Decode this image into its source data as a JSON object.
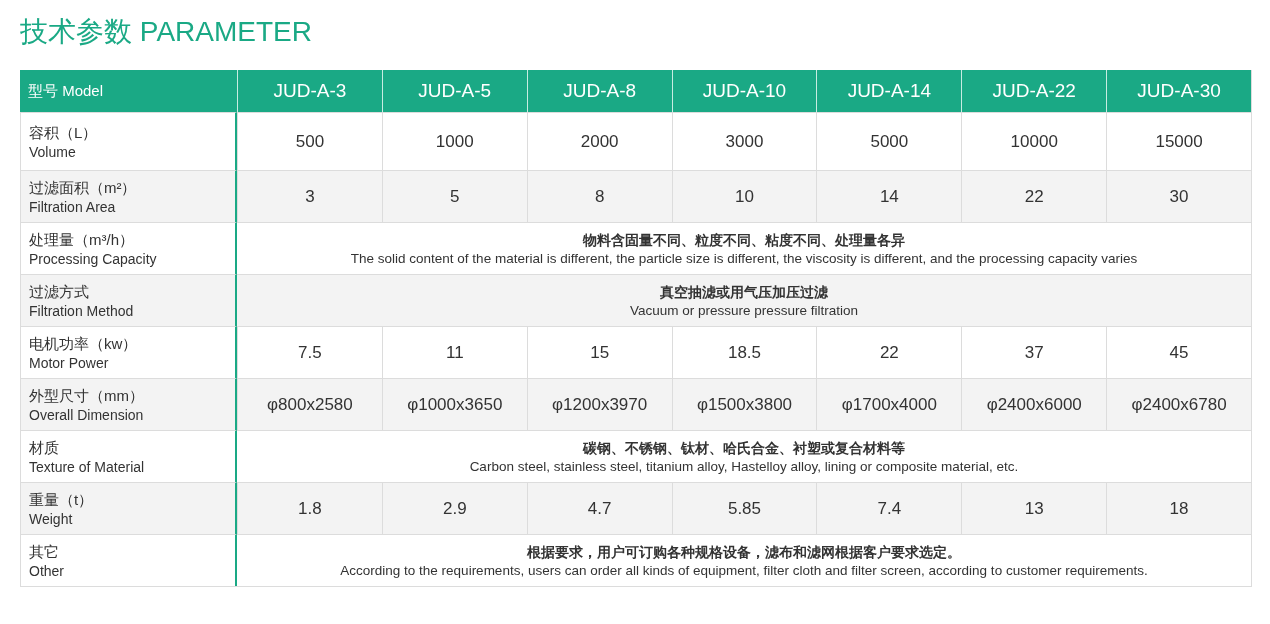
{
  "title": {
    "zh": "技术参数",
    "en": "PARAMETER"
  },
  "table": {
    "header_label": "型号 Model",
    "models": [
      "JUD-A-3",
      "JUD-A-5",
      "JUD-A-8",
      "JUD-A-10",
      "JUD-A-14",
      "JUD-A-22",
      "JUD-A-30"
    ],
    "rows": [
      {
        "kind": "values",
        "label_zh": "容积（L）",
        "label_en": "Volume",
        "values": [
          "500",
          "1000",
          "2000",
          "3000",
          "5000",
          "10000",
          "15000"
        ]
      },
      {
        "kind": "values",
        "label_zh": "过滤面积（m²）",
        "label_en": "Filtration Area",
        "values": [
          "3",
          "5",
          "8",
          "10",
          "14",
          "22",
          "30"
        ]
      },
      {
        "kind": "merged",
        "label_zh": "处理量（m³/h）",
        "label_en": "Processing Capacity",
        "text_zh": "物料含固量不同、粒度不同、粘度不同、处理量各异",
        "text_en": "The solid content of the material is different, the particle size is different, the viscosity is different, and the processing capacity varies"
      },
      {
        "kind": "merged",
        "label_zh": "过滤方式",
        "label_en": "Filtration Method",
        "text_zh": "真空抽滤或用气压加压过滤",
        "text_en": "Vacuum or pressure pressure filtration"
      },
      {
        "kind": "values",
        "label_zh": "电机功率（kw）",
        "label_en": "Motor Power",
        "values": [
          "7.5",
          "11",
          "15",
          "18.5",
          "22",
          "37",
          "45"
        ]
      },
      {
        "kind": "values",
        "label_zh": "外型尺寸（mm）",
        "label_en": "Overall Dimension",
        "values": [
          "φ800x2580",
          "φ1000x3650",
          "φ1200x3970",
          "φ1500x3800",
          "φ1700x4000",
          "φ2400x6000",
          "φ2400x6780"
        ]
      },
      {
        "kind": "merged",
        "label_zh": "材质",
        "label_en": "Texture of Material",
        "text_zh": "碳钢、不锈钢、钛材、哈氏合金、衬塑或复合材料等",
        "text_en": "Carbon steel, stainless steel, titanium alloy, Hastelloy alloy, lining or composite material, etc."
      },
      {
        "kind": "values",
        "label_zh": "重量（t）",
        "label_en": "Weight",
        "values": [
          "1.8",
          "2.9",
          "4.7",
          "5.85",
          "7.4",
          "13",
          "18"
        ]
      },
      {
        "kind": "merged",
        "label_zh": "其它",
        "label_en": "Other",
        "text_zh": "根据要求，用户可订购各种规格设备，滤布和滤网根据客户要求选定。",
        "text_en": "According to the requirements, users can order all kinds of equipment, filter cloth and filter screen, according to customer requirements."
      }
    ]
  }
}
